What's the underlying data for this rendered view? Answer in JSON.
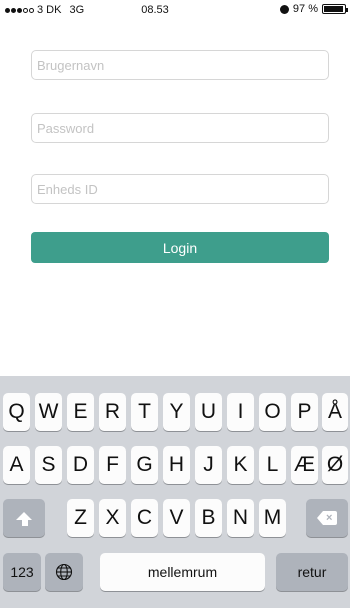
{
  "status_bar": {
    "carrier": "3 DK",
    "network": "3G",
    "time": "08.53",
    "battery": "97 %",
    "signal_bars_filled": 3,
    "signal_bars_total": 5
  },
  "form": {
    "username_placeholder": "Brugernavn",
    "password_placeholder": "Password",
    "device_id_placeholder": "Enheds ID",
    "login_label": "Login",
    "accent_color": "#3e9e8c"
  },
  "keyboard": {
    "row1": [
      "Q",
      "W",
      "E",
      "R",
      "T",
      "Y",
      "U",
      "I",
      "O",
      "P",
      "Å"
    ],
    "row2": [
      "A",
      "S",
      "D",
      "F",
      "G",
      "H",
      "J",
      "K",
      "L",
      "Æ",
      "Ø"
    ],
    "row3": [
      "Z",
      "X",
      "C",
      "V",
      "B",
      "N",
      "M"
    ],
    "numbers_label": "123",
    "space_label": "mellemrum",
    "return_label": "retur",
    "shift_icon": "shift-icon",
    "backspace_icon": "backspace-icon",
    "globe_icon": "globe-icon"
  }
}
